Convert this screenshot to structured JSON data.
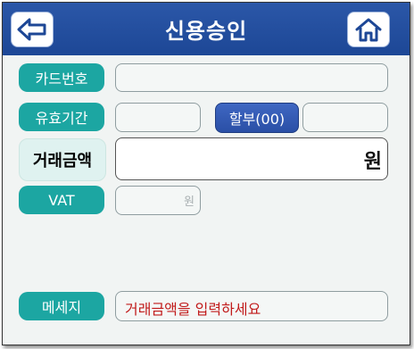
{
  "header": {
    "title": "신용승인",
    "back_icon": "arrow-left-icon",
    "home_icon": "home-icon"
  },
  "form": {
    "card_number_label": "카드번호",
    "expiry_label": "유효기간",
    "installment_button": "할부(00)",
    "amount_label": "거래금액",
    "amount_unit": "원",
    "vat_label": "VAT",
    "vat_unit": "원",
    "message_label": "메세지",
    "message_text": "거래금액을 입력하세요"
  },
  "colors": {
    "header_blue": "#2454a8",
    "label_teal": "#1ca6a2",
    "message_red": "#c11b1b"
  }
}
